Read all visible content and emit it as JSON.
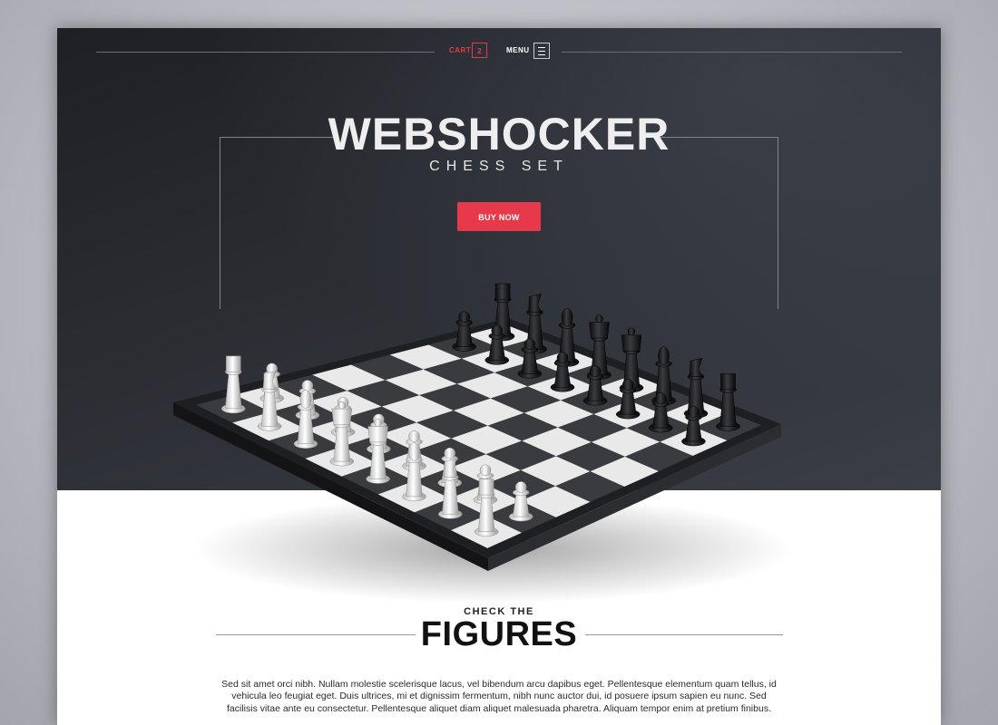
{
  "nav": {
    "cart_label": "CART",
    "cart_count": "2",
    "menu_label": "MENU"
  },
  "hero": {
    "title": "WEBSHOCKER",
    "subtitle": "CHESS SET",
    "cta_label": "BUY NOW"
  },
  "section": {
    "kicker": "CHECK THE",
    "title": "FIGURES",
    "description": "Sed sit amet orci nibh. Nullam molestie scelerisque lacus, vel bibendum arcu dapibus eget. Pellentesque elementum quam tellus, id vehicula leo feugiat eget. Duis ultrices, mi et dignissim fermentum, nibh nunc auctor dui, id posuere ipsum sapien eu nunc. Sed facilisis vitae ante eu consectetur. Pellentesque aliquet diam aliquet malesuada pharetra. Aliquam tempor enim at pretium finibus."
  },
  "colors": {
    "accent": "#e8394a",
    "hero_dark": "#2b2d33"
  },
  "icons": {
    "menu": "hamburger-icon"
  }
}
